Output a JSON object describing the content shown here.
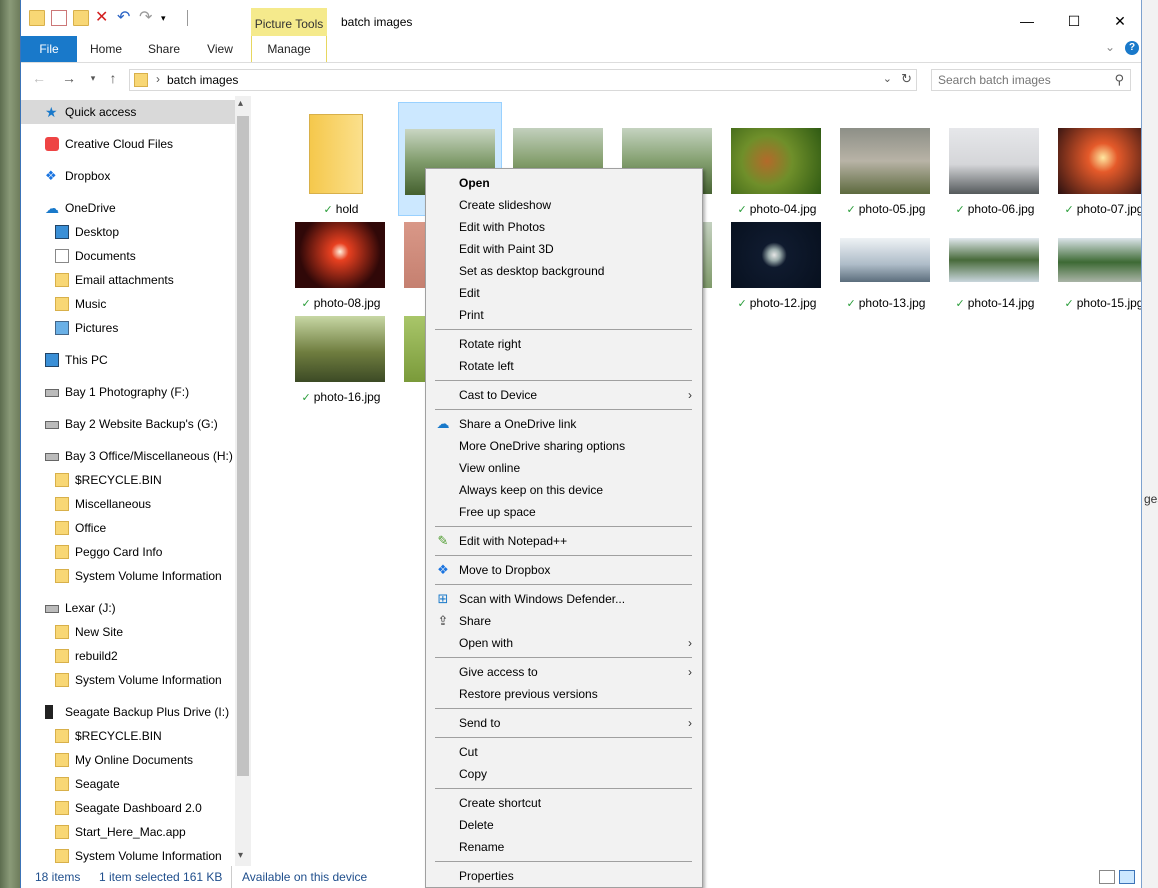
{
  "window": {
    "title": "batch images",
    "picture_tools": "Picture Tools",
    "controls": [
      "—",
      "☐",
      "✕"
    ]
  },
  "ribbon": {
    "tabs": [
      "File",
      "Home",
      "Share",
      "View",
      "Manage"
    ]
  },
  "address": {
    "path": "batch images",
    "search_placeholder": "Search batch images"
  },
  "nav": [
    {
      "label": "Quick access",
      "icon": "star-icon",
      "selected": true
    },
    {
      "label": "Creative Cloud Files",
      "icon": "creative-cloud-icon"
    },
    {
      "label": "Dropbox",
      "icon": "dropbox-icon"
    },
    {
      "label": "OneDrive",
      "icon": "onedrive-icon"
    },
    {
      "label": "Desktop",
      "icon": "desktop-icon"
    },
    {
      "label": "Documents",
      "icon": "documents-icon"
    },
    {
      "label": "Email attachments",
      "icon": "folder-icon"
    },
    {
      "label": "Music",
      "icon": "folder-icon"
    },
    {
      "label": "Pictures",
      "icon": "pictures-icon"
    },
    {
      "label": "This PC",
      "icon": "pc-icon"
    },
    {
      "label": "Bay 1 Photography (F:)",
      "icon": "drive-icon"
    },
    {
      "label": "Bay 2 Website Backup's (G:)",
      "icon": "drive-icon"
    },
    {
      "label": "Bay 3 Office/Miscellaneous  (H:)",
      "icon": "drive-icon"
    },
    {
      "label": "$RECYCLE.BIN",
      "icon": "folder-icon"
    },
    {
      "label": "Miscellaneous",
      "icon": "folder-icon"
    },
    {
      "label": "Office",
      "icon": "folder-icon"
    },
    {
      "label": "Peggo Card Info",
      "icon": "folder-icon"
    },
    {
      "label": "System Volume Information",
      "icon": "folder-icon"
    },
    {
      "label": "Lexar (J:)",
      "icon": "drive-icon"
    },
    {
      "label": "New Site",
      "icon": "folder-icon"
    },
    {
      "label": "rebuild2",
      "icon": "folder-icon"
    },
    {
      "label": "System Volume Information",
      "icon": "folder-icon"
    },
    {
      "label": "Seagate Backup Plus Drive (I:)",
      "icon": "external-drive-icon"
    },
    {
      "label": "$RECYCLE.BIN",
      "icon": "folder-icon"
    },
    {
      "label": "My Online Documents",
      "icon": "folder-icon"
    },
    {
      "label": "Seagate",
      "icon": "folder-icon"
    },
    {
      "label": "Seagate Dashboard 2.0",
      "icon": "folder-icon"
    },
    {
      "label": "Start_Here_Mac.app",
      "icon": "folder-icon"
    },
    {
      "label": "System Volume Information",
      "icon": "folder-icon"
    }
  ],
  "files": [
    {
      "name": "hold",
      "kind": "folder"
    },
    {
      "name": "phot",
      "kind": "image",
      "selected": true
    },
    {
      "name": "",
      "kind": "image"
    },
    {
      "name": "",
      "kind": "image"
    },
    {
      "name": "photo-04.jpg",
      "kind": "image"
    },
    {
      "name": "photo-05.jpg",
      "kind": "image"
    },
    {
      "name": "photo-06.jpg",
      "kind": "image"
    },
    {
      "name": "photo-07.jpg",
      "kind": "image"
    },
    {
      "name": "photo-08.jpg",
      "kind": "image"
    },
    {
      "name": "phot",
      "kind": "image"
    },
    {
      "name": "",
      "kind": "image"
    },
    {
      "name": "",
      "kind": "image"
    },
    {
      "name": "photo-12.jpg",
      "kind": "image"
    },
    {
      "name": "photo-13.jpg",
      "kind": "image"
    },
    {
      "name": "photo-14.jpg",
      "kind": "image"
    },
    {
      "name": "photo-15.jpg",
      "kind": "image"
    },
    {
      "name": "photo-16.jpg",
      "kind": "image"
    },
    {
      "name": "phot",
      "kind": "image"
    }
  ],
  "status": {
    "count": "18 items",
    "selection": "1 item selected  161 KB",
    "availability": "Available on this device"
  },
  "context_menu": [
    {
      "label": "Open",
      "bold": true
    },
    {
      "label": "Create slideshow"
    },
    {
      "label": "Edit with Photos"
    },
    {
      "label": "Edit with Paint 3D"
    },
    {
      "label": "Set as desktop background"
    },
    {
      "label": "Edit"
    },
    {
      "label": "Print"
    },
    {
      "sep": true
    },
    {
      "label": "Rotate right"
    },
    {
      "label": "Rotate left"
    },
    {
      "sep": true
    },
    {
      "label": "Cast to Device",
      "submenu": true
    },
    {
      "sep": true
    },
    {
      "label": "Share a OneDrive link",
      "icon": "onedrive-icon"
    },
    {
      "label": "More OneDrive sharing options"
    },
    {
      "label": "View online"
    },
    {
      "label": "Always keep on this device"
    },
    {
      "label": "Free up space"
    },
    {
      "sep": true
    },
    {
      "label": "Edit with Notepad++",
      "icon": "notepad-plus-plus-icon"
    },
    {
      "sep": true
    },
    {
      "label": "Move to Dropbox",
      "icon": "dropbox-icon"
    },
    {
      "sep": true
    },
    {
      "label": "Scan with Windows Defender...",
      "icon": "windows-defender-icon"
    },
    {
      "label": "Share",
      "icon": "share-icon"
    },
    {
      "label": "Open with",
      "submenu": true
    },
    {
      "sep": true
    },
    {
      "label": "Give access to",
      "submenu": true
    },
    {
      "label": "Restore previous versions"
    },
    {
      "sep": true
    },
    {
      "label": "Send to",
      "submenu": true
    },
    {
      "sep": true
    },
    {
      "label": "Cut"
    },
    {
      "label": "Copy"
    },
    {
      "sep": true
    },
    {
      "label": "Create shortcut"
    },
    {
      "label": "Delete"
    },
    {
      "label": "Rename"
    },
    {
      "sep": true
    },
    {
      "label": "Properties"
    }
  ],
  "desktop_edge_text": "ges"
}
